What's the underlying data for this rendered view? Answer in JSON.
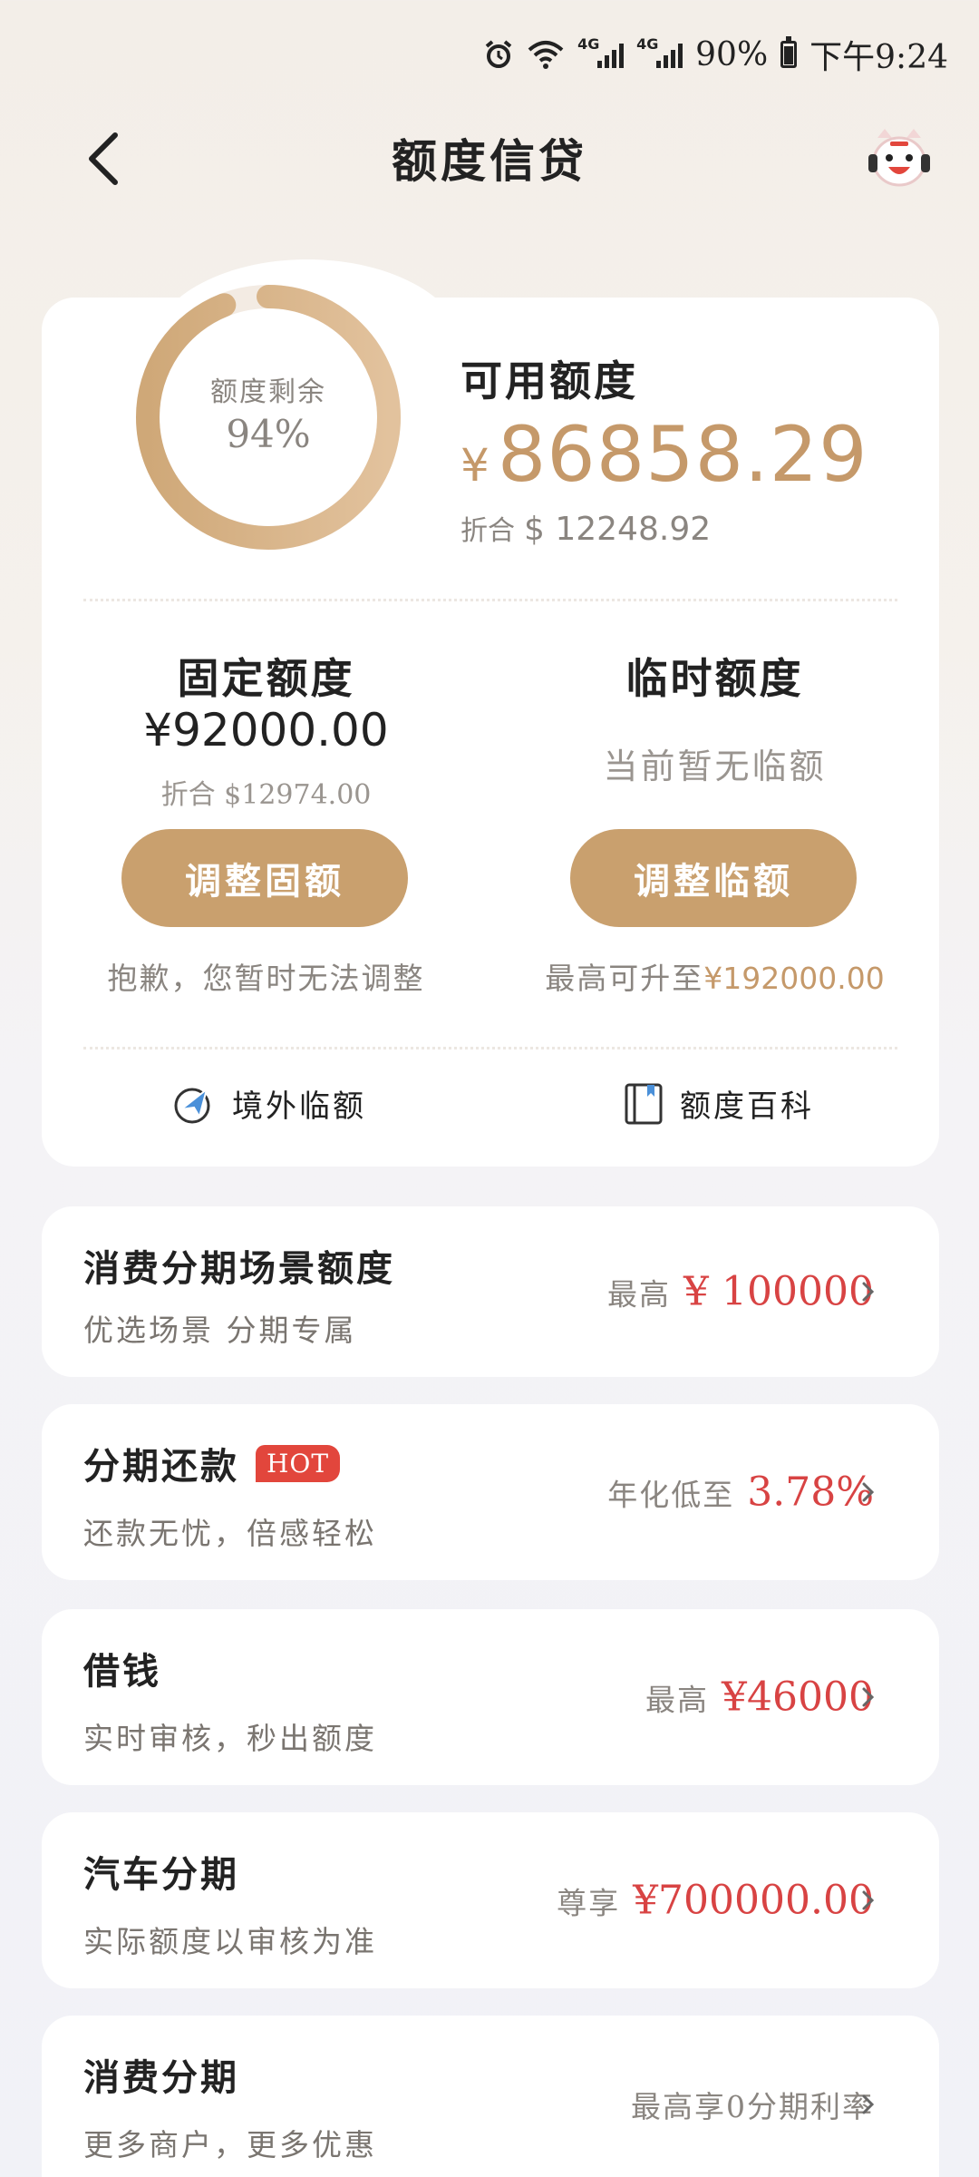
{
  "status_bar": {
    "network1": "4G",
    "network2": "4G",
    "battery": "90%",
    "time": "下午9:24"
  },
  "header": {
    "title": "额度信贷"
  },
  "summary": {
    "ring_label": "额度剩余",
    "ring_value": "94%",
    "ring_fraction": 0.94,
    "available_label": "可用额度",
    "available_currency": "¥",
    "available_amount": "86858.29",
    "available_usd_label": "折合",
    "available_usd": "$ 12248.92",
    "fixed": {
      "title": "固定额度",
      "amount": "¥92000.00",
      "usd": "折合 $12974.00",
      "button": "调整固额",
      "note": "抱歉，您暂时无法调整"
    },
    "temporary": {
      "title": "临时额度",
      "status": "当前暂无临额",
      "button": "调整临额",
      "note_prefix": "最高可升至",
      "note_amount": "¥192000.00"
    },
    "links": {
      "overseas": "境外临额",
      "encyclopedia": "额度百科"
    }
  },
  "list": [
    {
      "title": "消费分期场景额度",
      "subtitle": "优选场景 分期专属",
      "prefix": "最高",
      "value": "¥ 100000",
      "badge": ""
    },
    {
      "title": "分期还款",
      "subtitle": "还款无忧，倍感轻松",
      "prefix": "年化低至",
      "value": "3.78%",
      "badge": "HOT"
    },
    {
      "title": "借钱",
      "subtitle": "实时审核，秒出额度",
      "prefix": "最高",
      "value": "¥46000",
      "badge": ""
    },
    {
      "title": "汽车分期",
      "subtitle": "实际额度以审核为准",
      "prefix": "尊享",
      "value": "¥700000.00",
      "badge": ""
    },
    {
      "title": "消费分期",
      "subtitle": "更多商户，更多优惠",
      "prefix": "最高享0分期利率",
      "value": "",
      "badge": ""
    }
  ],
  "colors": {
    "accent": "#c9a06e",
    "highlight_red": "#d84343",
    "ring_track": "#f1e8df"
  }
}
